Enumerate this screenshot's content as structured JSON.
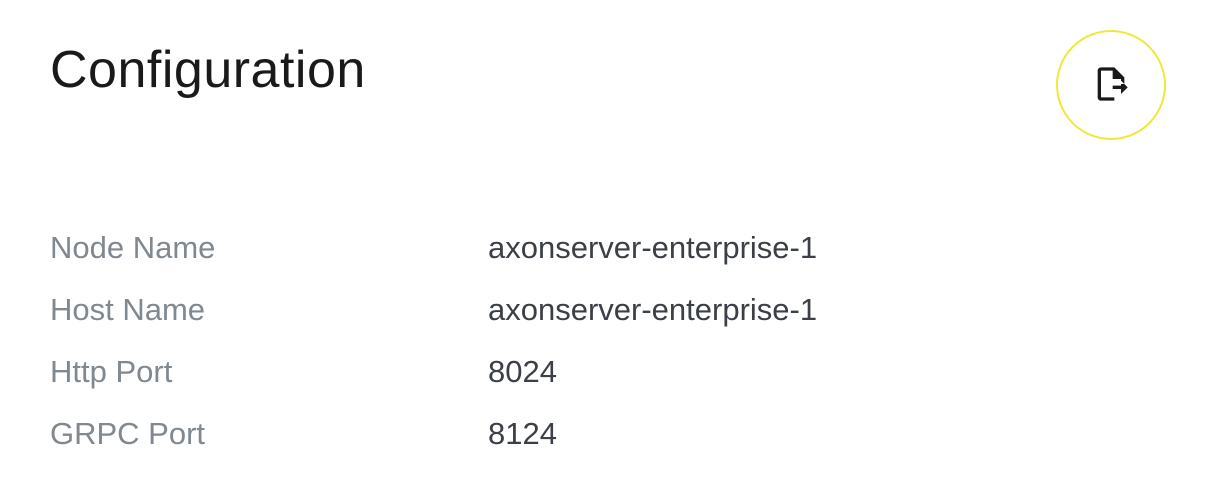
{
  "title": "Configuration",
  "config": {
    "rows": [
      {
        "label": "Node Name",
        "value": "axonserver-enterprise-1"
      },
      {
        "label": "Host Name",
        "value": "axonserver-enterprise-1"
      },
      {
        "label": "Http Port",
        "value": "8024"
      },
      {
        "label": "GRPC Port",
        "value": "8124"
      }
    ]
  }
}
